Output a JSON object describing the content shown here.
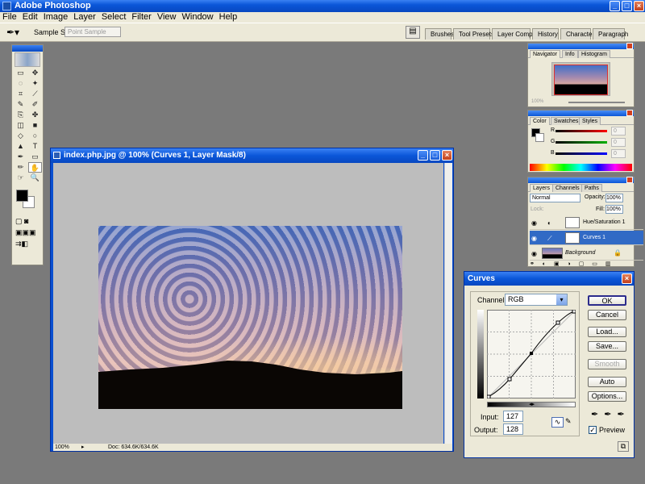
{
  "app": {
    "title": "Adobe Photoshop",
    "window_buttons": [
      "_",
      "□",
      "×"
    ]
  },
  "menu": [
    "File",
    "Edit",
    "Image",
    "Layer",
    "Select",
    "Filter",
    "View",
    "Window",
    "Help"
  ],
  "options": {
    "sample_size_label": "Sample Size:",
    "sample_size_value": "Point Sample"
  },
  "palette_well": [
    "Brushes",
    "Tool Presets",
    "Layer Comps",
    "History",
    "Character",
    "Paragraph"
  ],
  "toolbox": {
    "tools": [
      "▭",
      "✥",
      "◌",
      "✦",
      "⌗",
      "⟋",
      "✎",
      "✐",
      "⎘",
      "✤",
      "◫",
      "■",
      "◇",
      "○",
      "▲",
      "T",
      "✒",
      "▭",
      "✏",
      "✋",
      "☞",
      "🔍"
    ]
  },
  "document": {
    "title": "index.php.jpg @ 100% (Curves 1, Layer Mask/8)",
    "zoom": "100%",
    "doc_info": "Doc: 634.6K/634.6K"
  },
  "navigator": {
    "tabs": [
      "Navigator",
      "Info",
      "Histogram"
    ],
    "zoom": "100%"
  },
  "color": {
    "tabs": [
      "Color",
      "Swatches",
      "Styles"
    ],
    "channels": [
      {
        "label": "R",
        "value": "0",
        "color": "#ff0000"
      },
      {
        "label": "G",
        "value": "0",
        "color": "#00b000"
      },
      {
        "label": "B",
        "value": "0",
        "color": "#0000ff"
      }
    ]
  },
  "layers": {
    "tabs": [
      "Layers",
      "Channels",
      "Paths"
    ],
    "blend_mode": "Normal",
    "opacity_label": "Opacity:",
    "opacity_value": "100%",
    "lock_label": "Lock:",
    "fill_label": "Fill:",
    "fill_value": "100%",
    "items": [
      {
        "name": "Hue/Saturation 1",
        "selected": false
      },
      {
        "name": "Curves 1",
        "selected": true
      },
      {
        "name": "Background",
        "selected": false
      }
    ]
  },
  "curves": {
    "title": "Curves",
    "channel_label": "Channel:",
    "channel_value": "RGB",
    "input_label": "Input:",
    "input_value": "127",
    "output_label": "Output:",
    "output_value": "128",
    "buttons": [
      "OK",
      "Cancel",
      "Load...",
      "Save...",
      "Smooth",
      "Auto",
      "Options..."
    ],
    "preview_label": "Preview",
    "preview_checked": true
  }
}
